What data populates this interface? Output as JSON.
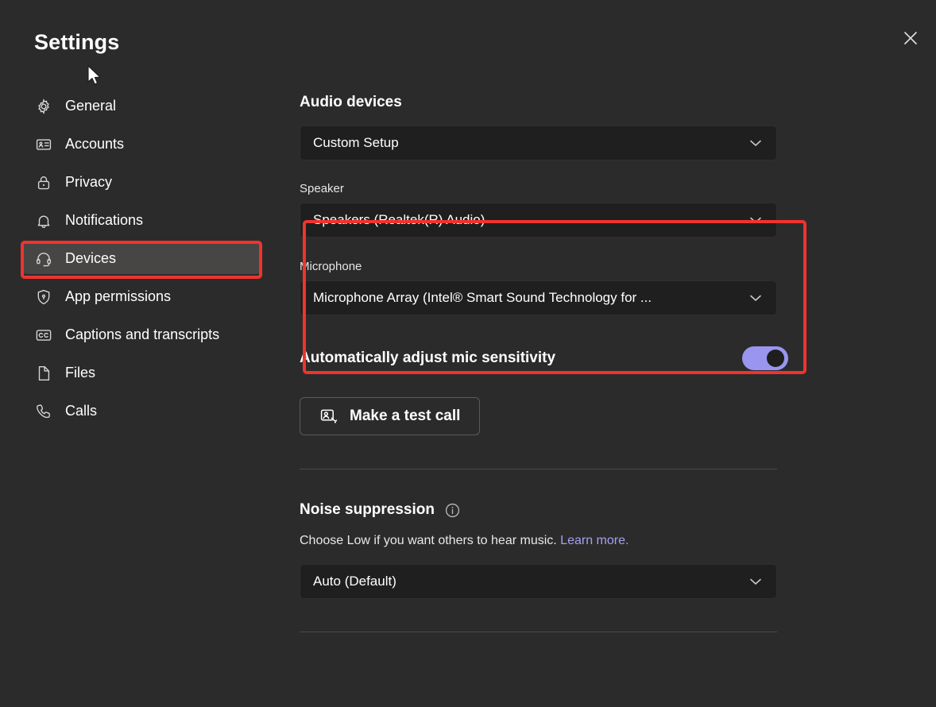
{
  "window": {
    "title": "Settings",
    "close_icon": "close-icon"
  },
  "sidebar": {
    "items": [
      {
        "label": "General",
        "icon": "gear-icon",
        "selected": false
      },
      {
        "label": "Accounts",
        "icon": "contact-card-icon",
        "selected": false
      },
      {
        "label": "Privacy",
        "icon": "lock-icon",
        "selected": false
      },
      {
        "label": "Notifications",
        "icon": "bell-icon",
        "selected": false
      },
      {
        "label": "Devices",
        "icon": "headset-icon",
        "selected": true
      },
      {
        "label": "App permissions",
        "icon": "shield-lock-icon",
        "selected": false
      },
      {
        "label": "Captions and transcripts",
        "icon": "closed-caption-icon",
        "selected": false
      },
      {
        "label": "Files",
        "icon": "file-icon",
        "selected": false
      },
      {
        "label": "Calls",
        "icon": "phone-icon",
        "selected": false
      }
    ]
  },
  "main": {
    "audio_devices": {
      "title": "Audio devices",
      "setup_value": "Custom Setup",
      "speaker_label": "Speaker",
      "speaker_value": "Speakers (Realtek(R) Audio)",
      "microphone_label": "Microphone",
      "microphone_value": "Microphone Array (Intel® Smart Sound Technology for ..."
    },
    "mic_sensitivity": {
      "label": "Automatically adjust mic sensitivity",
      "state": "on"
    },
    "test_call": {
      "label": "Make a test call",
      "icon": "person-call-icon"
    },
    "noise_suppression": {
      "title": "Noise suppression",
      "info_icon": "info-icon",
      "helper_text": "Choose Low if you want others to hear music.",
      "link_text": "Learn more.",
      "value": "Auto (Default)"
    }
  },
  "annotations": {
    "color": "#f0332e",
    "boxes": [
      {
        "name": "devices-nav-highlight"
      },
      {
        "name": "audio-device-selectors-highlight"
      }
    ]
  },
  "colors": {
    "page_background": "#2b2b2b",
    "dropdown_background": "#1f1f1f",
    "selected_nav_background": "#484644",
    "toggle_on": "#9a95ee",
    "link": "#a6a0f0",
    "annotation_red": "#f0332e"
  }
}
